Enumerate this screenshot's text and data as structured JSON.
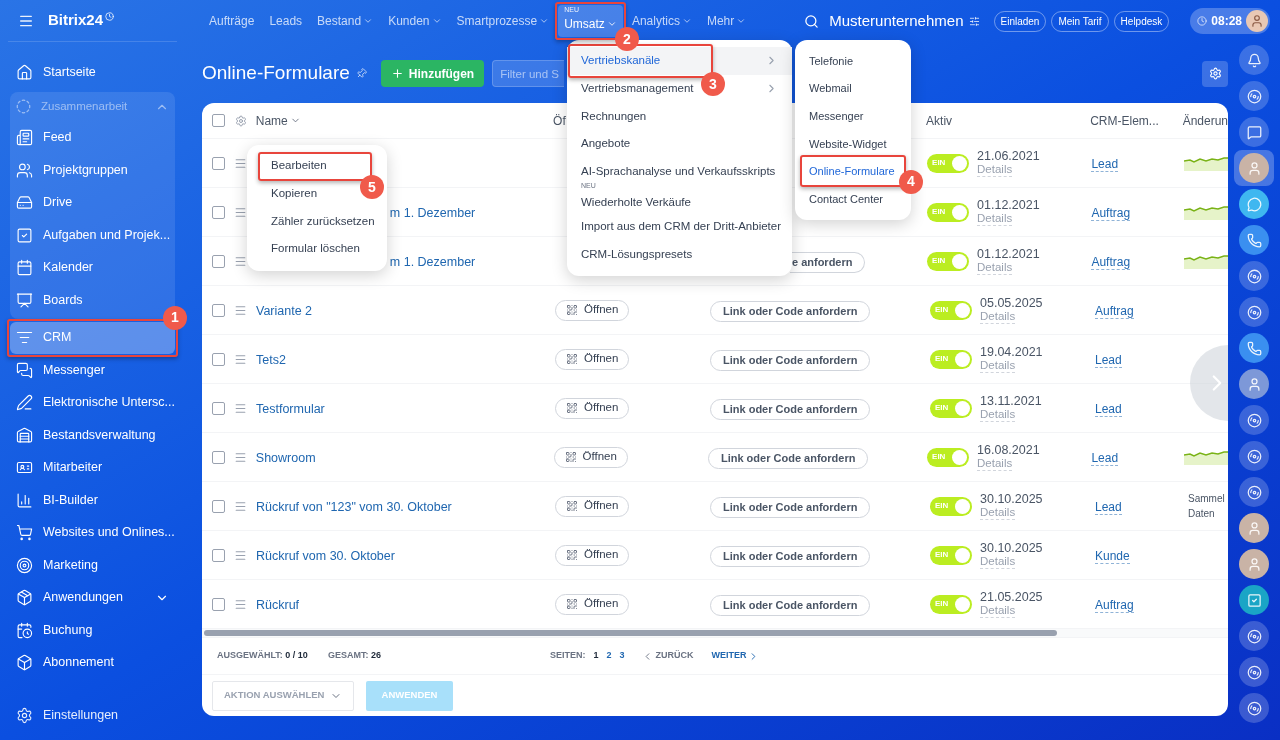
{
  "sidebar": {
    "logo": "Bitrix24",
    "items": [
      {
        "label": "Startseite",
        "selected": false
      },
      {
        "label": "Zusammenarbeit",
        "kind": "group",
        "expanded": true,
        "selected": false,
        "children": [
          {
            "label": "Feed",
            "selected": false
          },
          {
            "label": "Projektgruppen",
            "selected": false
          },
          {
            "label": "Drive",
            "selected": false
          },
          {
            "label": "Aufgaben und Projek...",
            "selected": false
          },
          {
            "label": "Kalender",
            "selected": false
          },
          {
            "label": "Boards",
            "selected": false
          }
        ]
      },
      {
        "label": "CRM",
        "selected": true,
        "callout": "1"
      },
      {
        "label": "Messenger",
        "selected": false
      },
      {
        "label": "Elektronische Untersc...",
        "selected": false
      },
      {
        "label": "Bestandsverwaltung",
        "selected": false
      },
      {
        "label": "Mitarbeiter",
        "selected": false
      },
      {
        "label": "BI-Builder",
        "selected": false
      },
      {
        "label": "Websites und Onlines...",
        "selected": false
      },
      {
        "label": "Marketing",
        "selected": false
      },
      {
        "label": "Anwendungen",
        "kind": "expandable",
        "expanded": false,
        "selected": false
      },
      {
        "label": "Buchung",
        "selected": false
      },
      {
        "label": "Abonnement",
        "selected": false
      }
    ],
    "settings": "Einstellungen"
  },
  "topbar": {
    "nav": [
      {
        "label": "Aufträge",
        "caret": false,
        "selected": false
      },
      {
        "label": "Leads",
        "caret": false,
        "selected": false
      },
      {
        "label": "Bestand",
        "caret": true,
        "selected": false
      },
      {
        "label": "Kunden",
        "caret": true,
        "selected": false
      },
      {
        "label": "Smartprozesse",
        "caret": true,
        "selected": false
      },
      {
        "label": "Umsatz",
        "caret": true,
        "selected": true,
        "badge": "NEU",
        "callout": "2"
      },
      {
        "label": "Analytics",
        "caret": true,
        "selected": false
      },
      {
        "label": "Mehr",
        "caret": true,
        "selected": false
      }
    ],
    "company": "Musterunternehmen",
    "buttons": [
      "Einladen",
      "Mein Tarif",
      "Helpdesk"
    ],
    "time": "08:28"
  },
  "page": {
    "title": "Online-Formulare",
    "add_button": "Hinzufügen",
    "filter_placeholder": "Filter und S"
  },
  "table": {
    "select_all": {
      "checked": false
    },
    "columns": [
      {
        "label": "Name",
        "caret": true
      },
      {
        "label": "Öf",
        "caret": false
      },
      {
        "label": "Aktiv",
        "caret": false
      },
      {
        "label": "CRM-Elem...",
        "caret": false
      },
      {
        "label": "Änderun",
        "caret": false
      }
    ],
    "rows": [
      {
        "checked": false,
        "active": true,
        "toggle_text": "EIN",
        "date": "21.06.2021",
        "details": "Details",
        "crm": "Lead",
        "sparkline": true
      },
      {
        "checked": false,
        "name": "m 1. Dezember",
        "name_partial": true,
        "active": true,
        "toggle_text": "EIN",
        "date": "01.12.2021",
        "details": "Details",
        "crm": "Auftrag",
        "sparkline": true
      },
      {
        "checked": false,
        "name": "m 1. Dezember",
        "name_partial": true,
        "link": "e anfordern",
        "link_partial": true,
        "active": true,
        "toggle_text": "EIN",
        "date": "01.12.2021",
        "details": "Details",
        "crm": "Auftrag",
        "sparkline": true
      },
      {
        "checked": false,
        "name": "Variante 2",
        "open": "Öffnen",
        "link": "Link oder Code anfordern",
        "active": true,
        "toggle_text": "EIN",
        "date": "05.05.2025",
        "details": "Details",
        "crm": "Auftrag",
        "sparkline": false
      },
      {
        "checked": false,
        "name": "Tets2",
        "open": "Öffnen",
        "link": "Link oder Code anfordern",
        "active": true,
        "toggle_text": "EIN",
        "date": "19.04.2021",
        "details": "Details",
        "crm": "Lead",
        "sparkline": false
      },
      {
        "checked": false,
        "name": "Testformular",
        "open": "Öffnen",
        "link": "Link oder Code anfordern",
        "active": true,
        "toggle_text": "EIN",
        "date": "13.11.2021",
        "details": "Details",
        "crm": "Lead",
        "sparkline": false
      },
      {
        "checked": false,
        "name": "Showroom",
        "open": "Öffnen",
        "link": "Link oder Code anfordern",
        "active": true,
        "toggle_text": "EIN",
        "date": "16.08.2021",
        "details": "Details",
        "crm": "Lead",
        "sparkline": true
      },
      {
        "checked": false,
        "name": "Rückruf von \"123\" vom 30. Oktober",
        "open": "Öffnen",
        "link": "Link oder Code anfordern",
        "active": true,
        "toggle_text": "EIN",
        "date": "30.10.2025",
        "details": "Details",
        "crm": "Lead",
        "sparkline": false,
        "change": "Sammel Daten"
      },
      {
        "checked": false,
        "name": "Rückruf vom 30. Oktober",
        "open": "Öffnen",
        "link": "Link oder Code anfordern",
        "active": true,
        "toggle_text": "EIN",
        "date": "30.10.2025",
        "details": "Details",
        "crm": "Kunde",
        "sparkline": false
      },
      {
        "checked": false,
        "name": "Rückruf",
        "open": "Öffnen",
        "link": "Link oder Code anfordern",
        "active": true,
        "toggle_text": "EIN",
        "date": "21.05.2025",
        "details": "Details",
        "crm": "Auftrag",
        "sparkline": false
      }
    ],
    "footer": {
      "selected_label": "AUSGEWÄHLT:",
      "selected_value": "0 / 10",
      "total_label": "GESAMT:",
      "total_value": "26",
      "pages_label": "SEITEN:",
      "pages": [
        {
          "label": "1",
          "selected": true
        },
        {
          "label": "2",
          "selected": false
        },
        {
          "label": "3",
          "selected": false
        }
      ],
      "prev": {
        "label": "ZURÜCK",
        "disabled": true
      },
      "next": {
        "label": "WEITER",
        "disabled": false
      }
    },
    "action_select": "AKTION AUSWÄHLEN",
    "apply": {
      "label": "ANWENDEN",
      "disabled": true
    }
  },
  "umsatz_menu": [
    {
      "label": "Vertriebskanäle",
      "submenu": true,
      "selected": true,
      "callout": "3"
    },
    {
      "label": "Vertriebsmanagement",
      "submenu": true,
      "selected": false
    },
    {
      "label": "Rechnungen",
      "submenu": false,
      "selected": false
    },
    {
      "label": "Angebote",
      "submenu": false,
      "selected": false
    },
    {
      "label": "AI-Sprachanalyse und Verkaufsskripts",
      "submenu": false,
      "selected": false
    },
    {
      "label": "Wiederholte Verkäufe",
      "submenu": false,
      "selected": false,
      "badge": "NEU"
    },
    {
      "label": "Import aus dem CRM der Dritt-Anbieter",
      "submenu": false,
      "selected": false
    },
    {
      "label": "CRM-Lösungspresets",
      "submenu": false,
      "selected": false
    }
  ],
  "submenu": [
    {
      "label": "Telefonie",
      "selected": false
    },
    {
      "label": "Webmail",
      "selected": false
    },
    {
      "label": "Messenger",
      "selected": false
    },
    {
      "label": "Website-Widget",
      "selected": false
    },
    {
      "label": "Online-Formulare",
      "selected": true,
      "callout": "4"
    },
    {
      "label": "Contact Center",
      "selected": false
    }
  ],
  "context_menu": [
    {
      "label": "Bearbeiten",
      "callout": "5"
    },
    {
      "label": "Kopieren"
    },
    {
      "label": "Zähler zurücksetzen"
    },
    {
      "label": "Formular löschen"
    }
  ],
  "rail": [
    {
      "kind": "bell",
      "selected": false
    },
    {
      "kind": "ring",
      "selected": false
    },
    {
      "kind": "chat",
      "selected": false
    },
    {
      "kind": "avatar",
      "selected": true
    },
    {
      "kind": "bubble",
      "selected": false
    },
    {
      "kind": "phone",
      "selected": false
    },
    {
      "kind": "ring",
      "selected": false
    },
    {
      "kind": "ring",
      "selected": false
    },
    {
      "kind": "phone",
      "selected": false
    },
    {
      "kind": "mascot",
      "selected": false
    },
    {
      "kind": "ring",
      "selected": false
    },
    {
      "kind": "ring",
      "selected": false
    },
    {
      "kind": "ring",
      "selected": false
    },
    {
      "kind": "avatar",
      "selected": false
    },
    {
      "kind": "avatar",
      "selected": false
    },
    {
      "kind": "check",
      "selected": false
    },
    {
      "kind": "ring",
      "selected": false
    },
    {
      "kind": "ring",
      "selected": false
    },
    {
      "kind": "ring",
      "selected": false
    }
  ]
}
